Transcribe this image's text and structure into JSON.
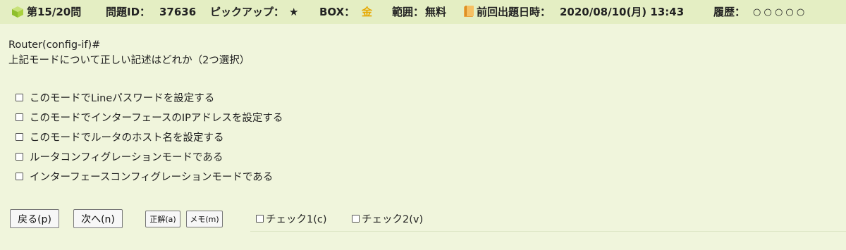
{
  "header": {
    "question_number": "第15/20問",
    "question_id_label": "問題ID：",
    "question_id": "37636",
    "pickup_label": "ピックアップ：",
    "pickup_value": "★",
    "box_label": "BOX：",
    "box_value": "金",
    "scope_label": "範囲：",
    "scope_value": "無料",
    "last_date_label": "前回出題日時：",
    "last_date_value": "2020/08/10(月) 13:43",
    "history_label": "履歴：",
    "history_marks": "○ ○ ○ ○ ○"
  },
  "question": {
    "prompt_line": "Router(config-if)#",
    "text": "上記モードについて正しい記述はどれか（2つ選択）"
  },
  "choices": [
    {
      "label": "このモードでLineパスワードを設定する",
      "checked": false
    },
    {
      "label": "このモードでインターフェースのIPアドレスを設定する",
      "checked": false
    },
    {
      "label": "このモードでルータのホスト名を設定する",
      "checked": false
    },
    {
      "label": "ルータコンフィグレーションモードである",
      "checked": false
    },
    {
      "label": "インターフェースコンフィグレーションモードである",
      "checked": false
    }
  ],
  "buttons": {
    "back": "戻る(p)",
    "next": "次へ(n)",
    "answer": "正解(a)",
    "memo": "メモ(m)"
  },
  "checks": {
    "check1": "チェック1(c)",
    "check2": "チェック2(v)"
  },
  "colors": {
    "background": "#f0f5dc",
    "header_background": "#e4eec3",
    "gold": "#e6a800"
  }
}
